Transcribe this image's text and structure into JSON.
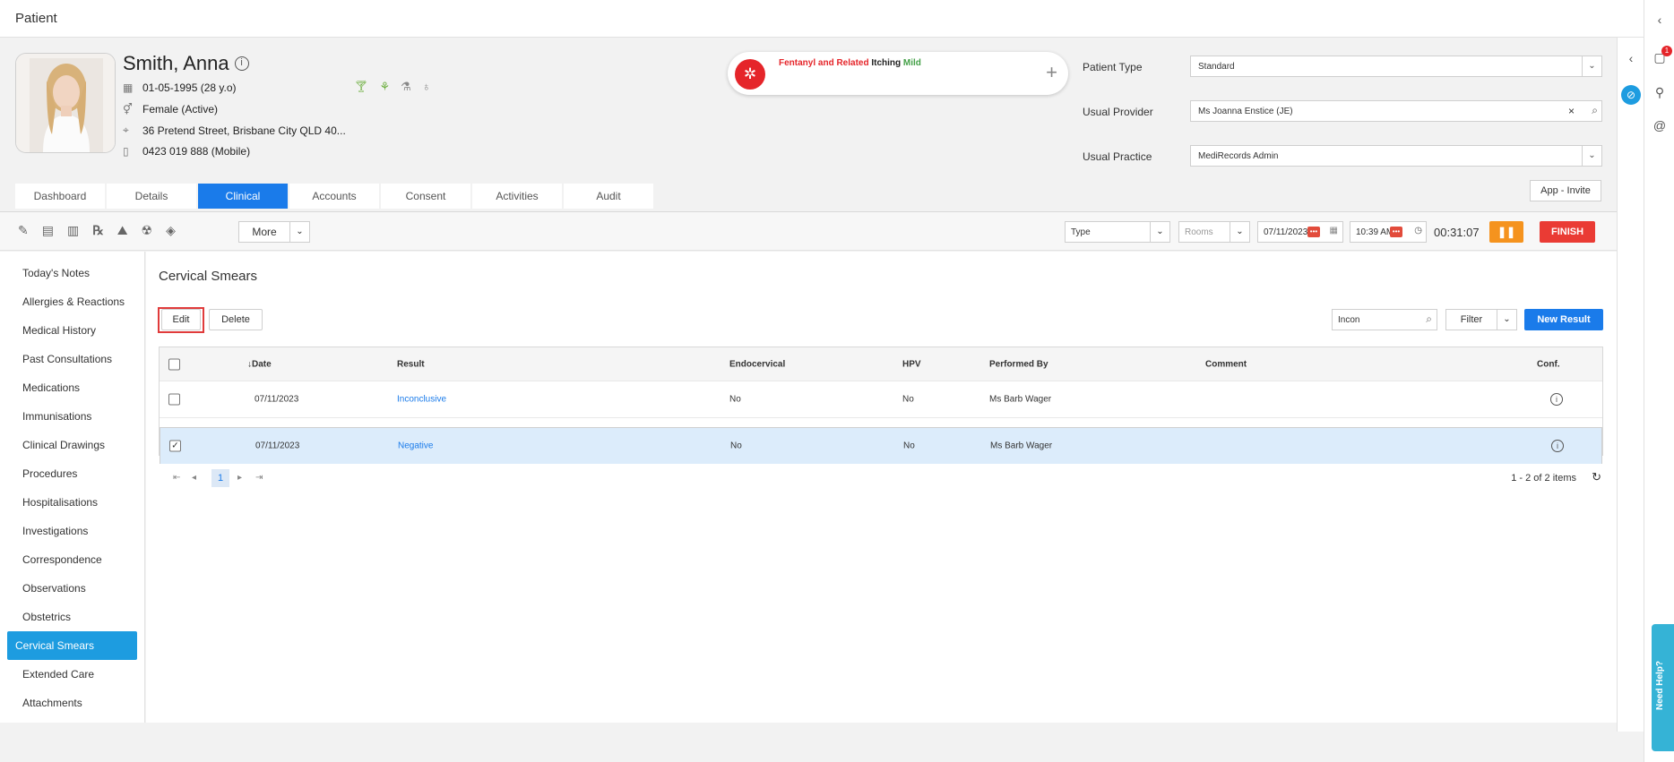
{
  "window": {
    "title": "Patient"
  },
  "patient": {
    "name": "Smith, Anna",
    "dob": "01-05-1995 (28 y.o)",
    "gender": "Female (Active)",
    "address": "36 Pretend Street, Brisbane City QLD 40...",
    "phone": "0423 019 888 (Mobile)"
  },
  "alert": {
    "drug": "Fentanyl and Related",
    "reaction": "Itching",
    "severity": "Mild"
  },
  "fields": {
    "patient_type_label": "Patient Type",
    "patient_type_value": "Standard",
    "usual_provider_label": "Usual Provider",
    "usual_provider_value": "Ms Joanna Enstice (JE)",
    "usual_practice_label": "Usual Practice",
    "usual_practice_value": "MediRecords Admin",
    "app_invite": "App - Invite"
  },
  "tabs": [
    {
      "label": "Dashboard"
    },
    {
      "label": "Details"
    },
    {
      "label": "Clinical"
    },
    {
      "label": "Accounts"
    },
    {
      "label": "Consent"
    },
    {
      "label": "Activities"
    },
    {
      "label": "Audit"
    }
  ],
  "toolbar": {
    "more": "More",
    "type_placeholder": "Type",
    "rooms_placeholder": "Rooms",
    "date": "07/11/2023",
    "time": "10:39 AM",
    "timer": "00:31:07",
    "pause": "❚❚",
    "finish": "FINISH"
  },
  "sidebar": {
    "items": [
      {
        "label": "Today's Notes"
      },
      {
        "label": "Allergies & Reactions"
      },
      {
        "label": "Medical History"
      },
      {
        "label": "Past Consultations"
      },
      {
        "label": "Medications"
      },
      {
        "label": "Immunisations"
      },
      {
        "label": "Clinical Drawings"
      },
      {
        "label": "Procedures"
      },
      {
        "label": "Hospitalisations"
      },
      {
        "label": "Investigations"
      },
      {
        "label": "Correspondence"
      },
      {
        "label": "Observations"
      },
      {
        "label": "Obstetrics"
      },
      {
        "label": "Cervical Smears"
      },
      {
        "label": "Extended Care"
      },
      {
        "label": "Attachments"
      }
    ]
  },
  "main": {
    "title": "Cervical Smears",
    "edit": "Edit",
    "delete": "Delete",
    "search_value": "Incon",
    "filter": "Filter",
    "new_result": "New Result",
    "columns": {
      "date": "↓Date",
      "result": "Result",
      "endocervical": "Endocervical",
      "hpv": "HPV",
      "performed_by": "Performed By",
      "comment": "Comment",
      "conf": "Conf."
    },
    "rows": [
      {
        "date": "07/11/2023",
        "result": "Inconclusive",
        "endocervical": "No",
        "hpv": "No",
        "performed_by": "Ms Barb Wager",
        "comment": "",
        "checked": false
      },
      {
        "date": "07/11/2023",
        "result": "Negative",
        "endocervical": "No",
        "hpv": "No",
        "performed_by": "Ms Barb Wager",
        "comment": "",
        "checked": true
      }
    ],
    "pager": {
      "current": "1",
      "info": "1 - 2 of 2 items"
    }
  },
  "right": {
    "notification_count": "1",
    "need_help": "Need Help?"
  },
  "colors": {
    "primary": "#1a7bea",
    "sidebar_active": "#1d9ce0",
    "finish": "#ea3b34",
    "pause": "#f5931e",
    "alert": "#e5252a"
  }
}
